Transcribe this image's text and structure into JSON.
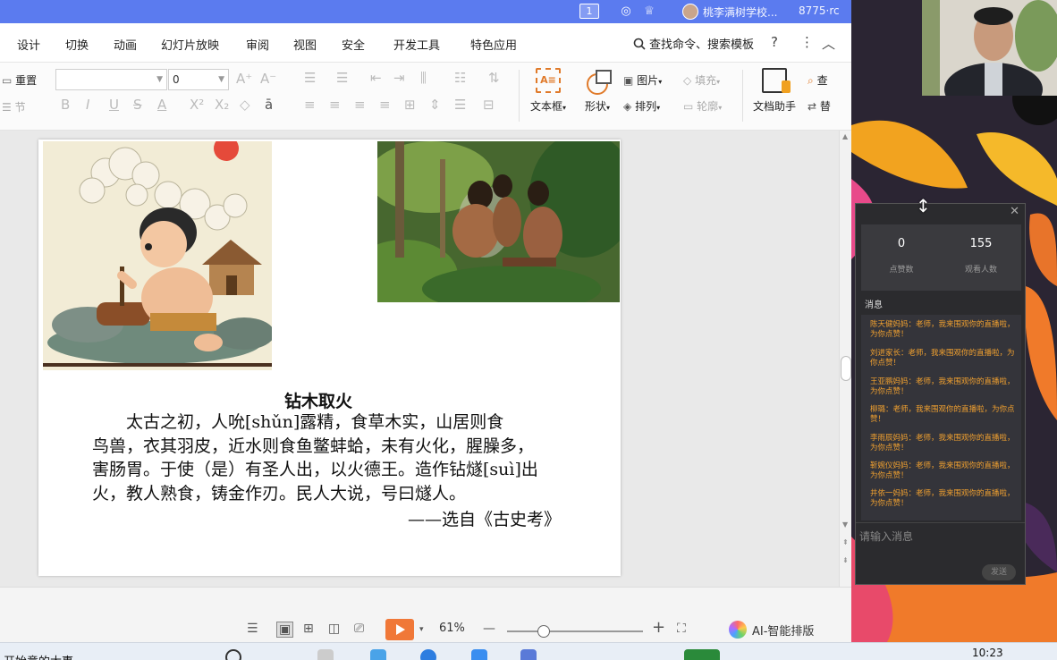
{
  "titlebar": {
    "window_badge": "1",
    "school": "桃李满树学校...",
    "user_id": "8775·rc"
  },
  "menu": {
    "tabs": [
      "设计",
      "切换",
      "动画",
      "幻灯片放映",
      "审阅",
      "视图",
      "安全",
      "开发工具",
      "特色应用"
    ],
    "search_label": "查找命令、搜索模板",
    "help_icon": "?",
    "more_icon": "⋮",
    "collapse_icon": "︿"
  },
  "ribbon": {
    "reset_label": "重置",
    "section_label": "节",
    "font_size_value": "0",
    "textbox_label": "文本框",
    "shape_label": "形状",
    "picture_label": "图片",
    "fill_label": "填充",
    "arrange_label": "排列",
    "outline_label": "轮廓",
    "doc_helper_label": "文档助手",
    "find_label": "查",
    "replace_label": "替"
  },
  "slide": {
    "title": "钻木取火",
    "lines": [
      "太古之初，人吮[shǔn]露精，食草木实，山居则食",
      "鸟兽，衣其羽皮，近水则食鱼鳖蚌蛤，未有火化，腥臊多，",
      "害肠胃。于使（是）有圣人出，以火德王。造作钻燧[suì]出",
      "火，教人熟食，铸金作刃。民人大说，号曰燧人。"
    ],
    "source": "——选自《古史考》"
  },
  "statusbar": {
    "zoom": "61%",
    "ai_label": "AI-智能排版"
  },
  "taskbar": {
    "search_text": "开始意的大事",
    "time": "10:23"
  },
  "live_panel": {
    "likes_value": "0",
    "likes_label": "点赞数",
    "viewers_value": "155",
    "viewers_label": "观看人数",
    "messages_header": "消息",
    "messages": [
      "陈天健妈妈：老师，我来围观你的直播啦，为你点赞！",
      "刘进家长：老师，我来围观你的直播啦，为你点赞！",
      "王亚鹏妈妈：老师，我来围观你的直播啦，为你点赞！",
      "柳璐：老师，我来围观你的直播啦，为你点赞！",
      "李雨辰妈妈：老师，我来围观你的直播啦，为你点赞！",
      "靳婉仪妈妈：老师，我来围观你的直播啦，为你点赞！",
      "井依一妈妈：老师，我来围观你的直播啦，为你点赞！"
    ],
    "input_placeholder": "请输入消息",
    "send_label": "发送"
  }
}
